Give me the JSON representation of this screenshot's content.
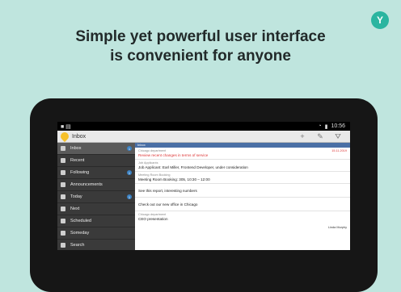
{
  "promo": {
    "logo_letter": "Y",
    "line1": "Simple yet powerful user interface",
    "line2": "is convenient for anyone"
  },
  "statusbar": {
    "time": "10:56"
  },
  "actionbar": {
    "title": "Inbox",
    "add_icon": "+",
    "edit_icon": "✎",
    "filter_icon": "⛛"
  },
  "sidebar": {
    "items": [
      {
        "label": "Inbox",
        "badge": "1",
        "icon": "inbox-icon"
      },
      {
        "label": "Recent",
        "badge": "",
        "icon": "clock-icon"
      },
      {
        "label": "Following",
        "badge": "1",
        "icon": "star-icon"
      },
      {
        "label": "Announcements",
        "badge": "",
        "icon": "megaphone-icon"
      },
      {
        "label": "Today",
        "badge": "1",
        "icon": "calendar-icon"
      },
      {
        "label": "Next",
        "badge": "",
        "icon": "next-icon"
      },
      {
        "label": "Scheduled",
        "badge": "",
        "icon": "schedule-icon"
      },
      {
        "label": "Someday",
        "badge": "",
        "icon": "someday-icon"
      },
      {
        "label": "Search",
        "badge": "",
        "icon": "search-icon"
      }
    ]
  },
  "content": {
    "header": "Inbox",
    "rows": [
      {
        "meta": "Chicago department",
        "text": "Review recent changes in terms of service",
        "red": true,
        "right": "15.11.2019",
        "user": ""
      },
      {
        "meta": "Job Applicants",
        "text": "Job Applicant: Earl Miller, Frontend Developer, under consideration",
        "red": false,
        "right": "",
        "user": ""
      },
      {
        "meta": "Meeting Room Booking",
        "text": "Meeting Room Booking: 305, 10:30 – 12:00",
        "red": false,
        "right": "",
        "user": ""
      },
      {
        "meta": "",
        "text": "See this report, interesting numbers",
        "red": false,
        "right": "",
        "user": ""
      },
      {
        "meta": "",
        "text": "Check out our new office in Chicago",
        "red": false,
        "right": "",
        "user": ""
      },
      {
        "meta": "Chicago department",
        "text": "CEO presentation",
        "red": false,
        "right": "",
        "user": "Linda Murphy"
      }
    ]
  }
}
